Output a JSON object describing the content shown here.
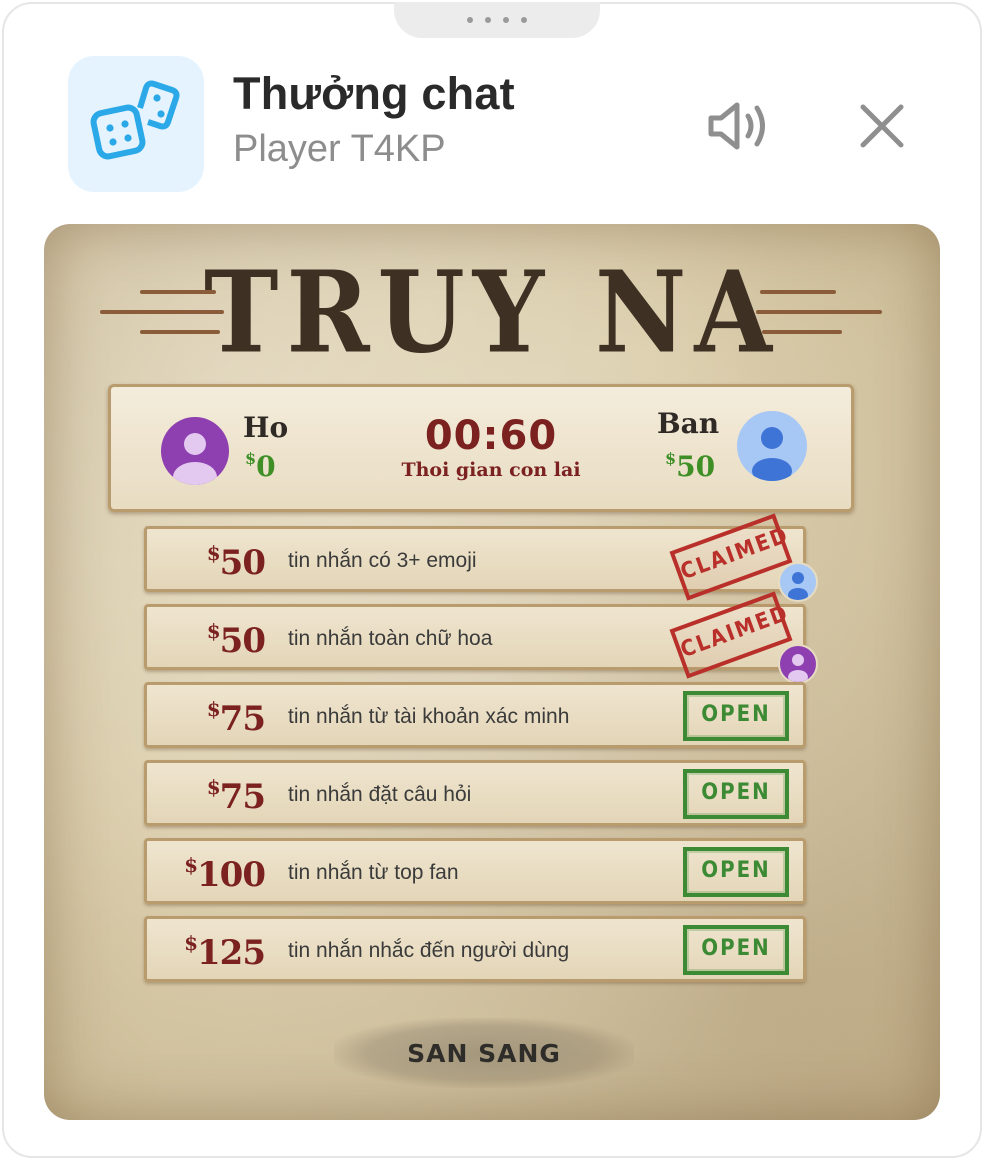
{
  "header": {
    "title": "Thưởng chat",
    "subtitle": "Player T4KP",
    "app_icon": "dice-icon",
    "sound_icon": "speaker-icon",
    "close_icon": "close-icon"
  },
  "poster": {
    "title": "TRUY NA",
    "timer": "00:60",
    "timer_label": "Thoi gian con lai",
    "left_player": {
      "name": "Ho",
      "currency": "$",
      "score": "0",
      "avatar_color": "#8e3fb0"
    },
    "right_player": {
      "name": "Ban",
      "currency": "$",
      "score": "50",
      "avatar_color": "#a7c7f5"
    },
    "bounties": [
      {
        "currency": "$",
        "amount": "50",
        "text": "tin nhắn có 3+ emoji",
        "status": "CLAIMED"
      },
      {
        "currency": "$",
        "amount": "50",
        "text": "tin nhắn toàn chữ hoa",
        "status": "CLAIMED"
      },
      {
        "currency": "$",
        "amount": "75",
        "text": "tin nhắn từ tài khoản xác minh",
        "status": "OPEN"
      },
      {
        "currency": "$",
        "amount": "75",
        "text": "tin nhắn đặt câu hỏi",
        "status": "OPEN"
      },
      {
        "currency": "$",
        "amount": "100",
        "text": "tin nhắn từ top fan",
        "status": "OPEN"
      },
      {
        "currency": "$",
        "amount": "125",
        "text": "tin nhắn nhắc đến người dùng",
        "status": "OPEN"
      }
    ],
    "ready_label": "SAN SANG"
  },
  "colors": {
    "accent_blue": "#2aa8e8",
    "wanted_red": "#7b2221",
    "claimed_red": "#b9302b",
    "open_green": "#3c8a34",
    "score_green": "#3f8f27"
  }
}
